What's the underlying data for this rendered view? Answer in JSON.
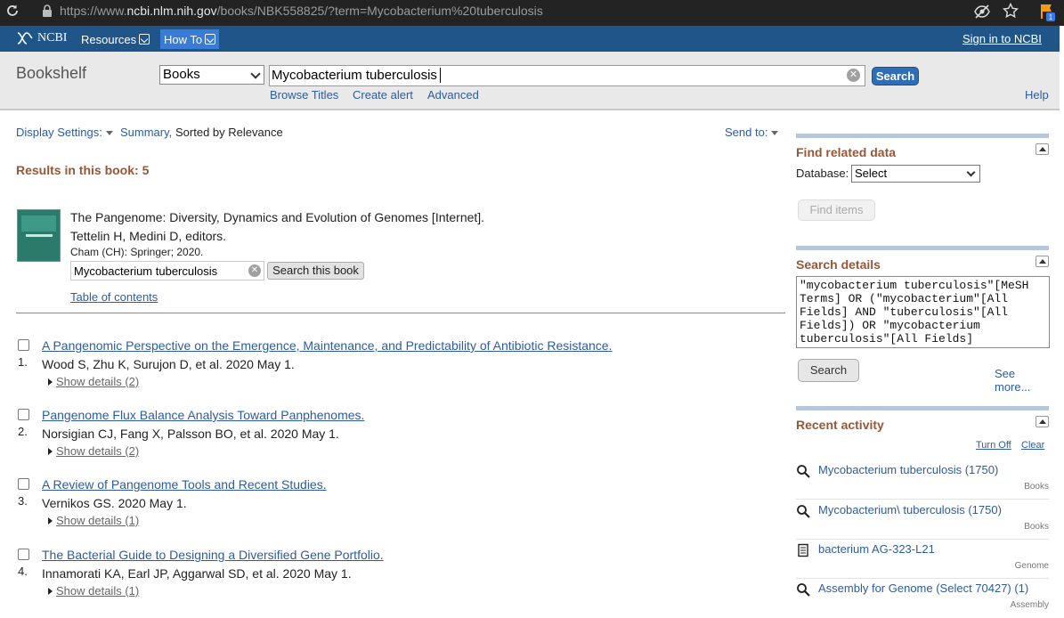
{
  "browser": {
    "url_prefix": "https://www.",
    "url_host": "ncbi.nlm.nih.gov",
    "url_rest": "/books/NBK558825/?term=Mycobacterium%20tuberculosis",
    "extension_badge": "1"
  },
  "ncbi_bar": {
    "logo_text": "NCBI",
    "resources_label": "Resources",
    "howto_label": "How To",
    "signin_label": "Sign in to NCBI"
  },
  "search": {
    "database_title": "Bookshelf",
    "database_selected": "Books",
    "term_value": "Mycobacterium tuberculosis",
    "search_button": "Search",
    "links": [
      "Browse Titles",
      "Create alert",
      "Advanced"
    ],
    "help_label": "Help"
  },
  "results_header": {
    "display_settings": "Display Settings:",
    "summary": "Summary,",
    "sorted": "Sorted by Relevance",
    "send_to": "Send to:",
    "results_in_book": "Results in this book: 5"
  },
  "book": {
    "title": "The Pangenome: Diversity, Dynamics and Evolution of Genomes [Internet].",
    "editors": "Tettelin H, Medini D, editors.",
    "publication": "Cham (CH): Springer; 2020.",
    "search_value": "Mycobacterium tuberculosis",
    "search_button": "Search this book",
    "toc_link": "Table of contents"
  },
  "results": [
    {
      "num": "1.",
      "title": "A Pangenomic Perspective on the Emergence, Maintenance, and Predictability of Antibiotic Resistance.",
      "authors": "Wood S, Zhu K, Surujon D, et al. 2020 May 1.",
      "details": "Show details (2)"
    },
    {
      "num": "2.",
      "title": "Pangenome Flux Balance Analysis Toward Panphenomes.",
      "authors": "Norsigian CJ, Fang X, Palsson BO, et al. 2020 May 1.",
      "details": "Show details (2)"
    },
    {
      "num": "3.",
      "title": "A Review of Pangenome Tools and Recent Studies.",
      "authors": "Vernikos GS. 2020 May 1.",
      "details": "Show details (1)"
    },
    {
      "num": "4.",
      "title": "The Bacterial Guide to Designing a Diversified Gene Portfolio.",
      "authors": "Innamorati KA, Earl JP, Aggarwal SD, et al. 2020 May 1.",
      "details": "Show details (1)"
    }
  ],
  "sidebar": {
    "find_related": {
      "title": "Find related data",
      "database_label": "Database:",
      "database_value": "Select",
      "find_items_button": "Find items"
    },
    "search_details": {
      "title": "Search details",
      "query": "\"mycobacterium tuberculosis\"[MeSH Terms] OR (\"mycobacterium\"[All Fields] AND \"tuberculosis\"[All Fields]) OR \"mycobacterium tuberculosis\"[All Fields]",
      "search_button": "Search",
      "see_more": "See more..."
    },
    "recent_activity": {
      "title": "Recent activity",
      "turn_off": "Turn Off",
      "clear": "Clear",
      "items": [
        {
          "text": "Mycobacterium tuberculosis (1750)",
          "db": "Books",
          "icon": "search-icon"
        },
        {
          "text": "Mycobacterium\\ tuberculosis (1750)",
          "db": "Books",
          "icon": "search-icon"
        },
        {
          "text": "bacterium AG-323-L21",
          "db": "Genome",
          "icon": "document-icon"
        },
        {
          "text": "Assembly for Genome (Select 70427) (1)",
          "db": "Assembly",
          "icon": "search-icon"
        }
      ]
    }
  }
}
